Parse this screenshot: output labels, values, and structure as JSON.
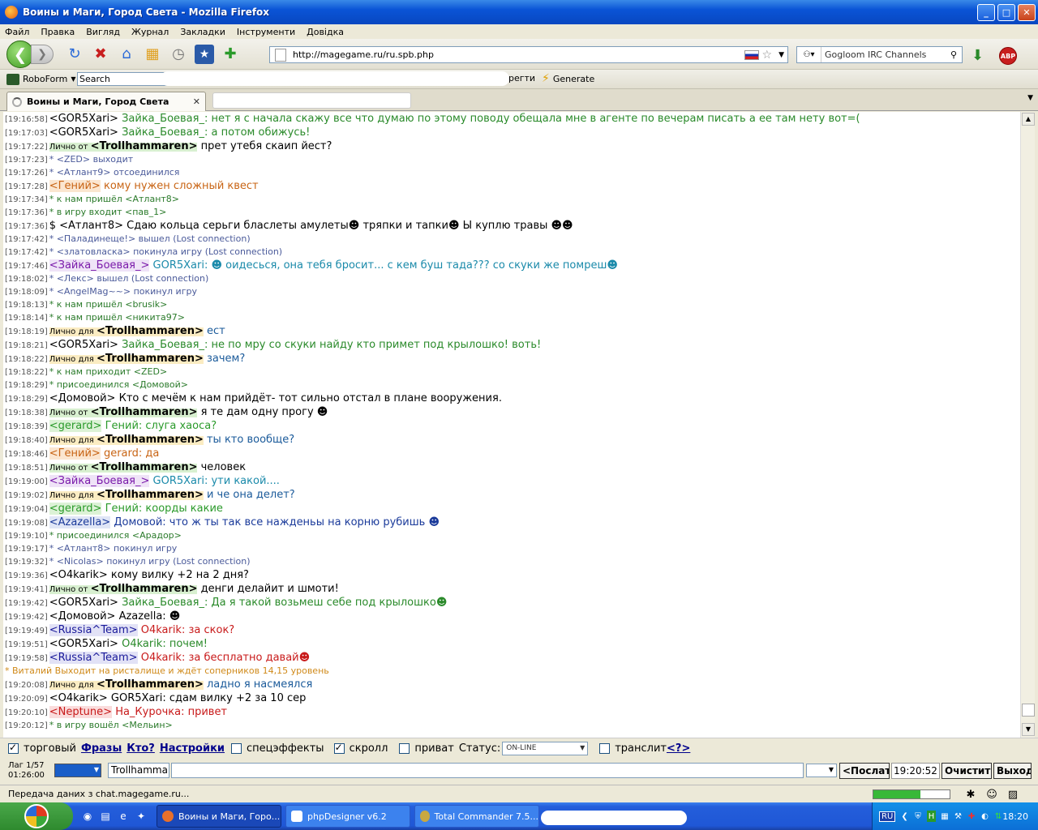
{
  "window": {
    "title": "Воины и Маги, Город Света - Mozilla Firefox"
  },
  "menu": [
    {
      "label": "Файл"
    },
    {
      "label": "Правка"
    },
    {
      "label": "Вигляд"
    },
    {
      "label": "Журнал"
    },
    {
      "label": "Закладки"
    },
    {
      "label": "Інструменти"
    },
    {
      "label": "Довідка"
    }
  ],
  "nav": {
    "url": "http://magegame.ru/ru.spb.php",
    "search_engine_placeholder": "Gogloom IRC Channels"
  },
  "roboform": {
    "label": "RoboForm",
    "search_value": "Search",
    "partial_text": "регти",
    "generate": "Generate"
  },
  "tab": {
    "title": "Воины и Маги, Город Света"
  },
  "chat": [
    {
      "t": "[19:16:58]",
      "kind": "say",
      "nick": "<GOR5Xari>",
      "text": " Зайка_Боевая_: нет я с начала скажу все что думаю по этому поводу обещала мне в агенте по вечерам писать а ее там нету вот=(",
      "nc": "#000",
      "tc": "#2a8a2a"
    },
    {
      "t": "[19:17:03]",
      "kind": "say",
      "nick": "<GOR5Xari>",
      "text": " Зайка_Боевая_: а потом обижусь!",
      "nc": "#000",
      "tc": "#2a8a2a"
    },
    {
      "t": "[19:17:22]",
      "kind": "pmfrom",
      "pre": "Лично от ",
      "nick": "<Trollhammaren>",
      "text": " прет утебя скаип йест?",
      "tc": "#000"
    },
    {
      "t": "[19:17:23]",
      "kind": "sys2",
      "text": "* <ZED> выходит"
    },
    {
      "t": "[19:17:26]",
      "kind": "sys2",
      "text": "* <Атлант9> отсоединился"
    },
    {
      "t": "[19:17:28]",
      "kind": "say",
      "nick": "<Гений>",
      "text": " кому нужен сложный квест",
      "nc": "#c86414",
      "tc": "#c86414",
      "nbg": "#fbe6d0"
    },
    {
      "t": "[19:17:34]",
      "kind": "sys",
      "text": "* к нам пришёл <Атлант8>"
    },
    {
      "t": "[19:17:36]",
      "kind": "sys",
      "text": "* в игру входит <пав_1>"
    },
    {
      "t": "[19:17:36]",
      "kind": "say",
      "nick": "$ <Атлант8>",
      "text": " Сдаю кольца серьги бласлеты амулеты☻ тряпки и тапки☻ Ы куплю травы ☻☻",
      "nc": "#000",
      "tc": "#000"
    },
    {
      "t": "[19:17:42]",
      "kind": "sys2",
      "text": "* <Паладинеще!> вышел (Lost connection)"
    },
    {
      "t": "[19:17:42]",
      "kind": "sys2",
      "text": "* <златовласка> покинула игру (Lost connection)"
    },
    {
      "t": "[19:17:46]",
      "kind": "say",
      "nick": "<Зайка_Боевая_>",
      "text": " GOR5Xari: ☻ оидесься, она тебя бросит... с кем буш тада??? со скуки же помреш☻",
      "nc": "#7a1aaa",
      "tc": "#1a8aaa",
      "nbg": "#efe3f7"
    },
    {
      "t": "[19:18:02]",
      "kind": "sys2",
      "text": "* <Лекс> вышел (Lost connection)"
    },
    {
      "t": "[19:18:09]",
      "kind": "sys2",
      "text": "* <AngelMag~~> покинул игру"
    },
    {
      "t": "[19:18:13]",
      "kind": "sys",
      "text": "* к нам пришёл <brusik>"
    },
    {
      "t": "[19:18:14]",
      "kind": "sys",
      "text": "* к нам пришёл <никита97>"
    },
    {
      "t": "[19:18:19]",
      "kind": "pmto",
      "pre": "Лично для ",
      "nick": "<Trollhammaren>",
      "text": " ест",
      "tc": "#1a5a9a"
    },
    {
      "t": "[19:18:21]",
      "kind": "say",
      "nick": "<GOR5Xari>",
      "text": " Зайка_Боевая_: не по мру со скуки найду кто примет под крылошко! воть!",
      "nc": "#000",
      "tc": "#2a8a2a"
    },
    {
      "t": "[19:18:22]",
      "kind": "pmto",
      "pre": "Лично для ",
      "nick": "<Trollhammaren>",
      "text": " зачем?",
      "tc": "#1a5a9a"
    },
    {
      "t": "[19:18:22]",
      "kind": "sys",
      "text": "* к нам приходит <ZED>"
    },
    {
      "t": "[19:18:29]",
      "kind": "sys",
      "text": "* присоединился <Домовой>"
    },
    {
      "t": "[19:18:29]",
      "kind": "say",
      "nick": "<Домовой>",
      "text": " Кто с мечём к нам прийдёт- тот сильно отстал в плане вооружения.",
      "nc": "#000",
      "tc": "#000"
    },
    {
      "t": "[19:18:38]",
      "kind": "pmfrom",
      "pre": "Лично от ",
      "nick": "<Trollhammaren>",
      "text": " я те дам одну прогу ☻",
      "tc": "#000"
    },
    {
      "t": "[19:18:39]",
      "kind": "say",
      "nick": "<gerard>",
      "text": " Гений: слуга хаоса?",
      "nc": "#2a9a2a",
      "tc": "#2a9a2a",
      "nbg": "#dcf2d6"
    },
    {
      "t": "[19:18:40]",
      "kind": "pmto",
      "pre": "Лично для ",
      "nick": "<Trollhammaren>",
      "text": " ты кто вообще?",
      "tc": "#1a5a9a"
    },
    {
      "t": "[19:18:46]",
      "kind": "say",
      "nick": "<Гений>",
      "text": " gerard: да",
      "nc": "#c86414",
      "tc": "#c86414",
      "nbg": "#fbe6d0"
    },
    {
      "t": "[19:18:51]",
      "kind": "pmfrom",
      "pre": "Лично от ",
      "nick": "<Trollhammaren>",
      "text": " человек",
      "tc": "#000"
    },
    {
      "t": "[19:19:00]",
      "kind": "say",
      "nick": "<Зайка_Боевая_>",
      "text": " GOR5Xari: ути какой....",
      "nc": "#7a1aaa",
      "tc": "#1a8aaa",
      "nbg": "#efe3f7"
    },
    {
      "t": "[19:19:02]",
      "kind": "pmto",
      "pre": "Лично для ",
      "nick": "<Trollhammaren>",
      "text": " и че она делет?",
      "tc": "#1a5a9a"
    },
    {
      "t": "[19:19:04]",
      "kind": "say",
      "nick": "<gerard>",
      "text": " Гений: коорды какие",
      "nc": "#2a9a2a",
      "tc": "#2a9a2a",
      "nbg": "#dcf2d6"
    },
    {
      "t": "[19:19:08]",
      "kind": "say",
      "nick": "<Azazella>",
      "text": " Домовой: что ж ты так все нажденьы на корню рубишь ☻",
      "nc": "#1a3a9a",
      "tc": "#1a3a9a",
      "nbg": "#e0e6f6"
    },
    {
      "t": "[19:19:10]",
      "kind": "sys",
      "text": "* присоединился <Арадор>"
    },
    {
      "t": "[19:19:17]",
      "kind": "sys2",
      "text": "* <Атлант8> покинул игру"
    },
    {
      "t": "[19:19:32]",
      "kind": "sys2",
      "text": "* <Nicolas> покинул игру (Lost connection)"
    },
    {
      "t": "[19:19:36]",
      "kind": "say",
      "nick": "<O4karik>",
      "text": " кому вилку +2 на 2 дня?",
      "nc": "#000",
      "tc": "#000"
    },
    {
      "t": "[19:19:41]",
      "kind": "pmfrom",
      "pre": "Лично от ",
      "nick": "<Trollhammaren>",
      "text": " денги делайит и шмоти!",
      "tc": "#000"
    },
    {
      "t": "[19:19:42]",
      "kind": "say",
      "nick": "<GOR5Xari>",
      "text": " Зайка_Боевая_: Да я такой возьмеш себе под крылошко☻",
      "nc": "#000",
      "tc": "#2a8a2a"
    },
    {
      "t": "[19:19:42]",
      "kind": "say",
      "nick": "<Домовой>",
      "text": " Azazella: ☻",
      "nc": "#000",
      "tc": "#000"
    },
    {
      "t": "[19:19:49]",
      "kind": "say",
      "nick": "<Russia^Team>",
      "text": " O4karik: за скок?",
      "nc": "#1a1a9a",
      "tc": "#c81a1a",
      "nbg": "#e2e2f6"
    },
    {
      "t": "[19:19:51]",
      "kind": "say",
      "nick": "<GOR5Xari>",
      "text": " O4karik: почем!",
      "nc": "#000",
      "tc": "#2a8a2a"
    },
    {
      "t": "[19:19:58]",
      "kind": "say",
      "nick": "<Russia^Team>",
      "text": " O4karik: за бесплатно давай☻",
      "nc": "#1a1a9a",
      "tc": "#c81a1a",
      "nbg": "#e2e2f6"
    },
    {
      "t": "",
      "kind": "gold",
      "text": "* Виталий Выходит на ристалище и ждёт соперников 14,15 уровень"
    },
    {
      "t": "[19:20:08]",
      "kind": "pmto",
      "pre": "Лично для ",
      "nick": "<Trollhammaren>",
      "text": " ладно я насмеялся",
      "tc": "#1a5a9a"
    },
    {
      "t": "[19:20:09]",
      "kind": "say",
      "nick": "<O4karik>",
      "text": " GOR5Xari: сдам вилку +2 за 10 сер",
      "nc": "#000",
      "tc": "#000"
    },
    {
      "t": "[19:20:10]",
      "kind": "say",
      "nick": "<Neptune>",
      "text": " На_Курочка: привет",
      "nc": "#c81a1a",
      "tc": "#c81a1a",
      "nbg": "#fadcdc"
    },
    {
      "t": "[19:20:12]",
      "kind": "sys",
      "text": "* в игру вошёл <Мельин>"
    }
  ],
  "bottom": {
    "trade_label": "торговый",
    "phrases": "Фразы",
    "who": "Кто?",
    "settings": "Настройки",
    "effects": "спецэффекты",
    "scroll": "скролл",
    "private": "приват",
    "status_label": "Статус:",
    "status_value": "ON-LINE",
    "translit": "транслит",
    "translit_help": "<?>",
    "lag": "Лаг 1/57",
    "lag_time": "01:26:00",
    "nick_value": "Trollhammaren",
    "send": "<Послать",
    "clock": "19:20:52",
    "clear": "Очистить",
    "exit": "Выход"
  },
  "statusbar": {
    "text": "Передача даних з chat.magegame.ru...",
    "progress": 0.62
  },
  "taskbar": {
    "tasks": [
      {
        "label": "Воины и Маги, Горо..."
      },
      {
        "label": "phpDesigner v6.2"
      },
      {
        "label": "Total Commander 7.5..."
      }
    ],
    "lang": "RU",
    "time": "18:20"
  }
}
